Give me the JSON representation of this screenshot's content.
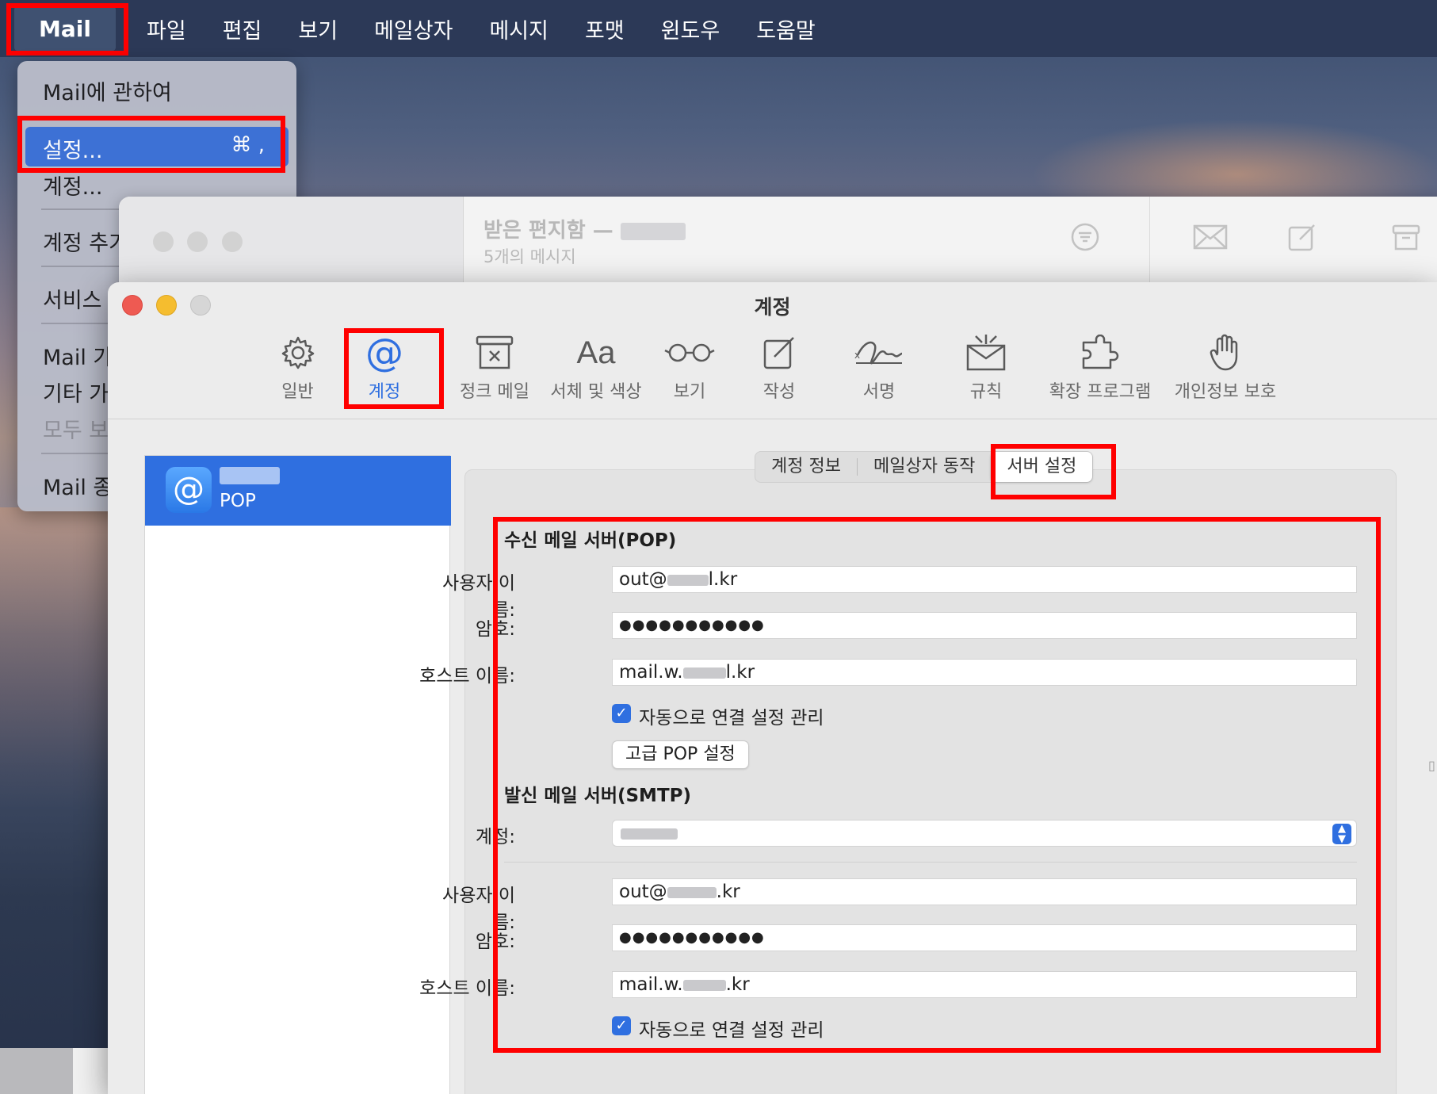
{
  "menubar": {
    "app_name": "Mail",
    "items": [
      "파일",
      "편집",
      "보기",
      "메일상자",
      "메시지",
      "포맷",
      "윈도우",
      "도움말"
    ]
  },
  "app_menu": {
    "about": "Mail에 관하여",
    "settings": "설정...",
    "settings_shortcut": "⌘ ,",
    "accounts": "계정...",
    "add_account": "계정 추가",
    "services": "서비스",
    "hide_mail": "Mail 가리기",
    "hide_others": "기타 가리기",
    "show_all": "모두 보기",
    "quit": "Mail 종료"
  },
  "mail_window": {
    "title": "받은 편지함 —",
    "subtitle": "5개의 메시지"
  },
  "prefs": {
    "title": "계정",
    "toolbar": [
      {
        "label": "일반",
        "icon": "gear-icon"
      },
      {
        "label": "계정",
        "icon": "at-icon"
      },
      {
        "label": "정크 메일",
        "icon": "junk-icon"
      },
      {
        "label": "서체 및 색상",
        "icon": "font-icon"
      },
      {
        "label": "보기",
        "icon": "glasses-icon"
      },
      {
        "label": "작성",
        "icon": "compose-icon"
      },
      {
        "label": "서명",
        "icon": "signature-icon"
      },
      {
        "label": "규칙",
        "icon": "rules-icon"
      },
      {
        "label": "확장 프로그램",
        "icon": "extensions-icon"
      },
      {
        "label": "개인정보 보호",
        "icon": "hand-icon"
      }
    ],
    "account": {
      "type": "POP"
    },
    "tabs": [
      "계정 정보",
      "메일상자 동작",
      "서버 설정"
    ],
    "incoming": {
      "title": "수신 메일 서버(POP)",
      "username_label": "사용자 이름:",
      "username_prefix": "out@",
      "username_suffix": "l.kr",
      "password_label": "암호:",
      "password": "●●●●●●●●●●●",
      "host_label": "호스트 이름:",
      "host_prefix": "mail.w.",
      "host_suffix": "l.kr",
      "auto_manage": "자동으로 연결 설정 관리",
      "advanced_button": "고급 POP 설정"
    },
    "outgoing": {
      "title": "발신 메일 서버(SMTP)",
      "account_label": "계정:",
      "username_label": "사용자 이름:",
      "username_prefix": "out@",
      "username_suffix": ".kr",
      "password_label": "암호:",
      "password": "●●●●●●●●●●●",
      "host_label": "호스트 이름:",
      "host_prefix": "mail.w.",
      "host_suffix": ".kr",
      "auto_manage": "자동으로 연결 설정 관리"
    }
  },
  "colors": {
    "highlight": "#ff0000",
    "accent": "#2f6fe0",
    "menubar": "#2c3957"
  }
}
